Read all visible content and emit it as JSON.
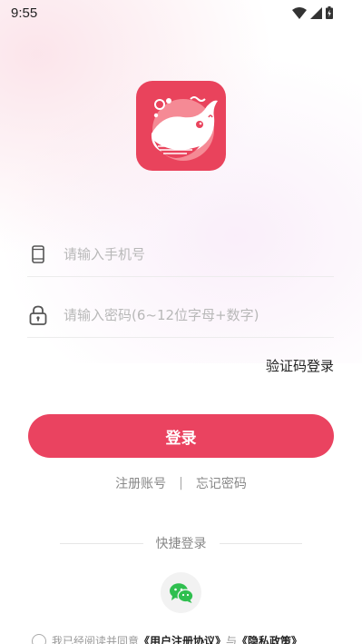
{
  "status_bar": {
    "time": "9:55",
    "icons": [
      "wifi-icon",
      "signal-icon",
      "battery-icon"
    ]
  },
  "logo": {
    "icon": "whale-logo-icon",
    "color": "#e9435c"
  },
  "phone_field": {
    "icon": "phone-icon",
    "placeholder": "请输入手机号",
    "value": ""
  },
  "password_field": {
    "icon": "lock-icon",
    "placeholder": "请输入密码(6~12位字母+数字)",
    "value": ""
  },
  "code_login_label": "验证码登录",
  "login_button_label": "登录",
  "links": {
    "register": "注册账号",
    "separator": "|",
    "forgot": "忘记密码"
  },
  "quick_login": {
    "title": "快捷登录",
    "wechat_icon": "wechat-icon"
  },
  "agreement": {
    "prefix": "我已经阅读并同意",
    "user_agreement": "《用户注册协议》",
    "conjunction": "与",
    "privacy": "《隐私政策》"
  },
  "colors": {
    "primary": "#ea4360",
    "wechat_green": "#2fbf4f"
  }
}
